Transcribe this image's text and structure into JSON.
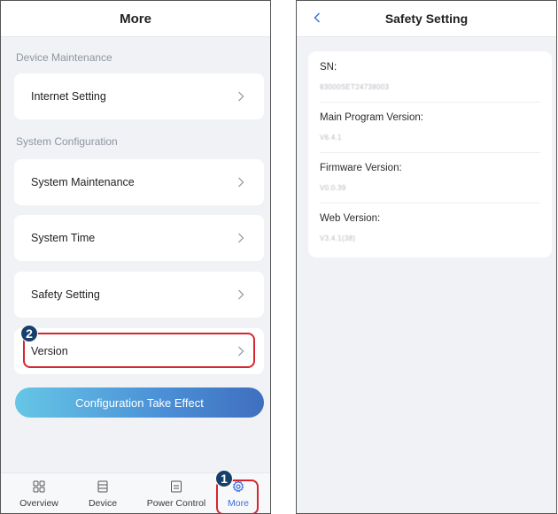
{
  "left": {
    "header": {
      "title": "More"
    },
    "sections": [
      {
        "label": "Device Maintenance"
      },
      {
        "label": "System Configuration"
      }
    ],
    "items": [
      {
        "label": "Internet Setting"
      },
      {
        "label": "System Maintenance"
      },
      {
        "label": "System Time"
      },
      {
        "label": "Safety Setting"
      },
      {
        "label": "Version"
      }
    ],
    "apply_button": "Configuration Take Effect",
    "steps": [
      "1",
      "2"
    ],
    "tabs": [
      {
        "label": "Overview",
        "icon": "grid-icon"
      },
      {
        "label": "Device",
        "icon": "device-icon"
      },
      {
        "label": "Power Control",
        "icon": "power-control-icon"
      },
      {
        "label": "More",
        "icon": "gear-icon",
        "active": true
      }
    ]
  },
  "right": {
    "header": {
      "title": "Safety Setting"
    },
    "info": [
      {
        "label": "SN:",
        "value": "83000SET24738003"
      },
      {
        "label": "Main Program Version:",
        "value": "V6.4.1"
      },
      {
        "label": "Firmware Version:",
        "value": "V0.0.39"
      },
      {
        "label": "Web Version:",
        "value": "V3.4.1(38)"
      }
    ]
  },
  "colors": {
    "highlight": "#d7252f",
    "badge": "#16406c",
    "active_tab": "#3b6fe0",
    "button_gradient_start": "#66c6e6",
    "button_gradient_end": "#3f6fbf"
  }
}
